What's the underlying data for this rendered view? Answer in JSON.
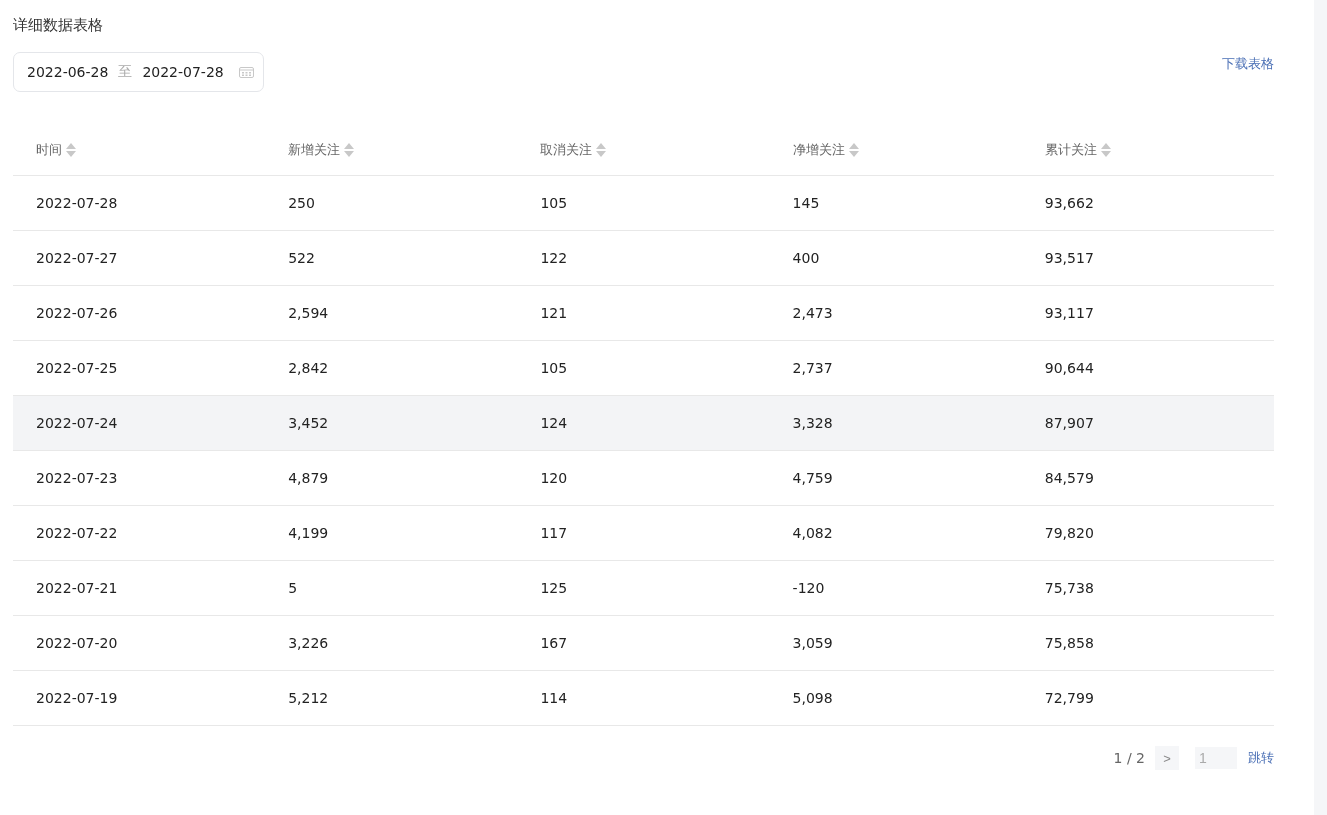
{
  "title": "详细数据表格",
  "date_range": {
    "start": "2022-06-28",
    "separator": "至",
    "end": "2022-07-28"
  },
  "download_link": "下载表格",
  "table": {
    "columns": [
      "时间",
      "新增关注",
      "取消关注",
      "净增关注",
      "累计关注"
    ],
    "rows": [
      {
        "cells": [
          "2022-07-28",
          "250",
          "105",
          "145",
          "93,662"
        ],
        "selected": false
      },
      {
        "cells": [
          "2022-07-27",
          "522",
          "122",
          "400",
          "93,517"
        ],
        "selected": false
      },
      {
        "cells": [
          "2022-07-26",
          "2,594",
          "121",
          "2,473",
          "93,117"
        ],
        "selected": false
      },
      {
        "cells": [
          "2022-07-25",
          "2,842",
          "105",
          "2,737",
          "90,644"
        ],
        "selected": false
      },
      {
        "cells": [
          "2022-07-24",
          "3,452",
          "124",
          "3,328",
          "87,907"
        ],
        "selected": true
      },
      {
        "cells": [
          "2022-07-23",
          "4,879",
          "120",
          "4,759",
          "84,579"
        ],
        "selected": false
      },
      {
        "cells": [
          "2022-07-22",
          "4,199",
          "117",
          "4,082",
          "79,820"
        ],
        "selected": false
      },
      {
        "cells": [
          "2022-07-21",
          "5",
          "125",
          "-120",
          "75,738"
        ],
        "selected": false
      },
      {
        "cells": [
          "2022-07-20",
          "3,226",
          "167",
          "3,059",
          "75,858"
        ],
        "selected": false
      },
      {
        "cells": [
          "2022-07-19",
          "5,212",
          "114",
          "5,098",
          "72,799"
        ],
        "selected": false
      }
    ]
  },
  "pagination": {
    "page_info": "1 / 2",
    "next": ">",
    "jump_placeholder": "1",
    "jump_button": "跳转"
  }
}
